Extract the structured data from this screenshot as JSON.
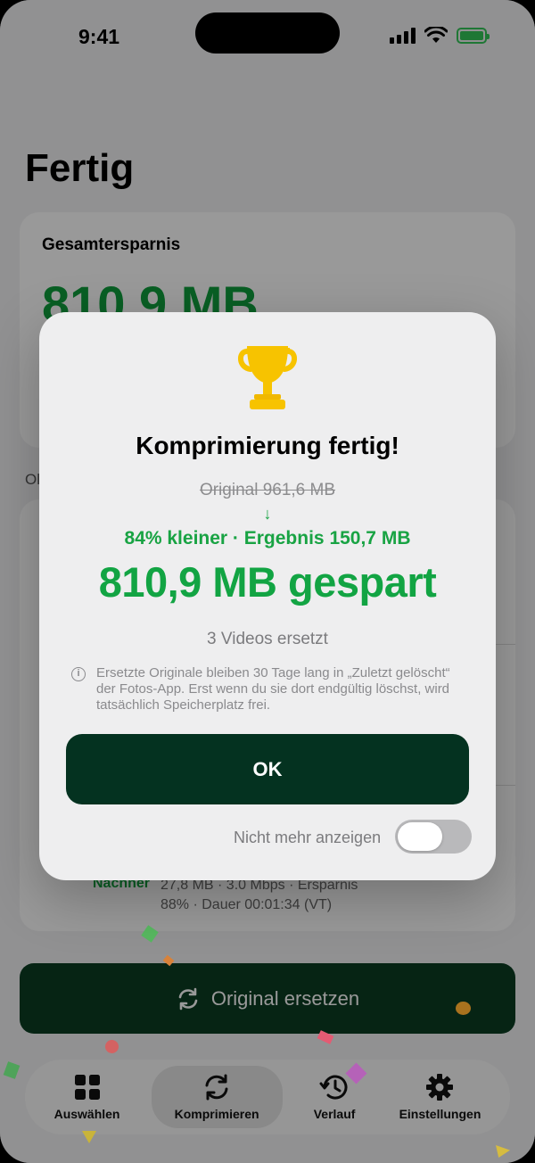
{
  "status": {
    "time": "9:41"
  },
  "page": {
    "title": "Fertig"
  },
  "summary": {
    "label": "Gesamtersparnis",
    "value": "810,9 MB"
  },
  "section_label": "Ol",
  "list_row": {
    "after_label": "Nachher",
    "after_value_line1": "27,8 MB · 3.0 Mbps · Ersparnis",
    "after_value_line2": "88% · Dauer 00:01:34 (VT)"
  },
  "replace_button": {
    "label": "Original ersetzen",
    "icon": "arrows-rotate-icon"
  },
  "tabs": [
    {
      "label": "Auswählen",
      "icon": "grid-icon",
      "active": false
    },
    {
      "label": "Komprimieren",
      "icon": "arrows-rotate-icon",
      "active": true
    },
    {
      "label": "Verlauf",
      "icon": "history-clock-icon",
      "active": false
    },
    {
      "label": "Einstellungen",
      "icon": "gear-icon",
      "active": false
    }
  ],
  "modal": {
    "icon": "trophy-icon",
    "title": "Komprimierung fertig!",
    "original": "Original 961,6 MB",
    "arrow": "↓",
    "result": "84% kleiner · Ergebnis 150,7 MB",
    "saved": "810,9 MB gespart",
    "count": "3 Videos ersetzt",
    "info": "Ersetzte Originale bleiben 30 Tage lang in „Zuletzt gelöscht“ der Fotos-App. Erst wenn du sie dort endgültig löschst, wird tatsächlich Speicherplatz frei.",
    "ok_label": "OK",
    "dont_show_label": "Nicht mehr anzeigen",
    "dont_show_enabled": false
  },
  "colors": {
    "accent_green": "#12a443",
    "dark_green": "#043220",
    "trophy_gold": "#f7c300"
  }
}
